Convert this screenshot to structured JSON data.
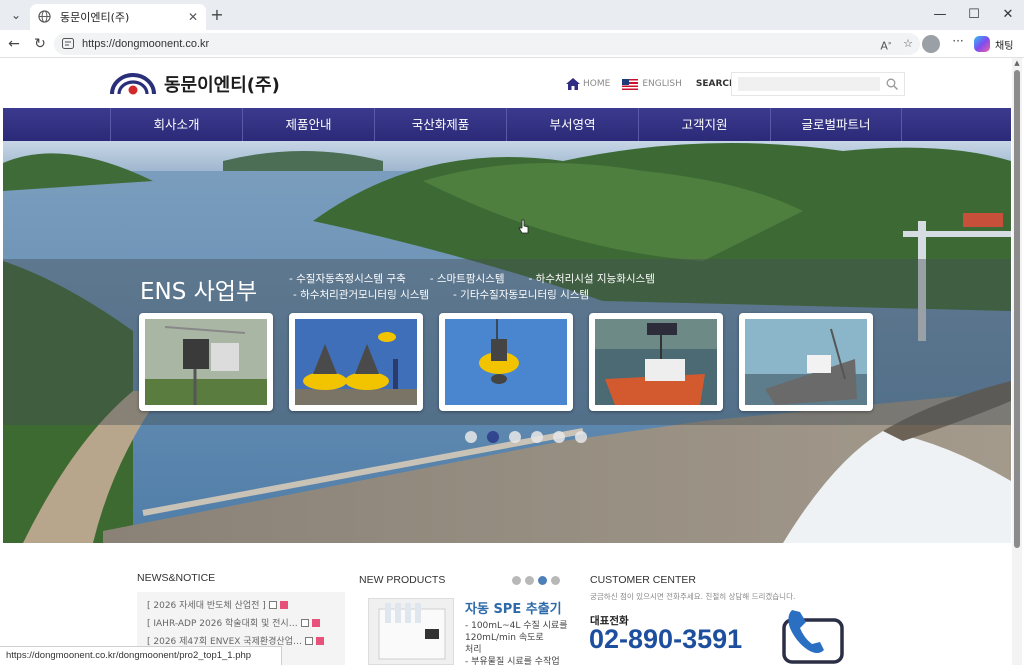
{
  "browser": {
    "tab_title": "동문이엔티(주)",
    "url": "https://dongmoonent.co.kr",
    "chat_label": "채팅",
    "status_url": "https://dongmoonent.co.kr/dongmoonent/pro2_top1_1.php"
  },
  "header": {
    "logo_text": "동문이엔티(주)",
    "home": "HOME",
    "english": "ENGLISH",
    "search": "SEARCH",
    "search_value": ""
  },
  "nav": [
    "회사소개",
    "제품안내",
    "국산화제품",
    "부서영역",
    "고객지원",
    "글로벌파트너"
  ],
  "hero": {
    "title": "ENS 사업부",
    "bullets_row1": [
      "- 수질자동측정시스템 구축",
      "- 스마트팜시스템",
      "- 하수처리시설 지능화시스템"
    ],
    "bullets_row2": [
      "- 하수처리관거모니터링 시스템",
      "- 기타수질자동모니터링 시스템"
    ],
    "slide_count": 6,
    "active_slide": 2
  },
  "news": {
    "title": "NEWS&NOTICE",
    "items": [
      "[ 2026 자세대 반도체 산업전 ]",
      "[ IAHR-ADP 2026 학술대회 및 전시…",
      "[ 2026 제47회 ENVEX 국제환경산업…"
    ]
  },
  "products": {
    "title": "NEW PRODUCTS",
    "name": "자동 SPE 추출기",
    "desc": [
      "- 100mL~4L 수질 시료를",
      "120mL/min 속도로",
      "처리",
      "- 부유물질 시료를 수작업"
    ],
    "page_count": 4,
    "active_page": 3
  },
  "customer": {
    "title": "CUSTOMER CENTER",
    "sub": "궁금하신 점이 있으시면 전화주세요. 친절히 상담해 드리겠습니다.",
    "phone_label": "대표전화",
    "phone": "02-890-3591"
  },
  "colors": {
    "nav_bg": "#2f2e80",
    "phone": "#1d4f9e",
    "active_dot": "#2a3a8a",
    "news_badge": "#e8517a"
  }
}
